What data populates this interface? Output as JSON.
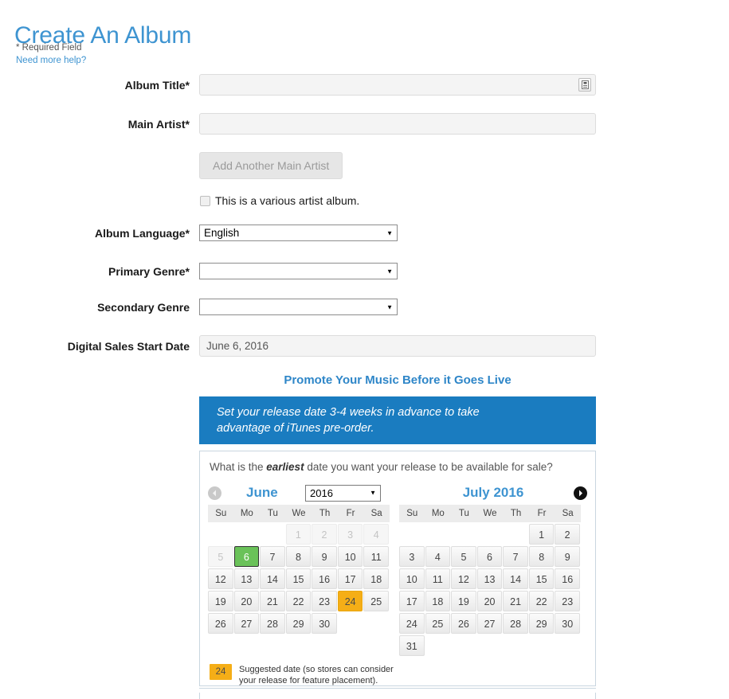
{
  "header": {
    "title": "Create An Album",
    "required_note": "* Required Field",
    "help_link": "Need more help?",
    "accent_blue": "#3e94d1"
  },
  "form": {
    "album_title": {
      "label": "Album Title*",
      "value": "",
      "icon": "id-card-icon"
    },
    "main_artist": {
      "label": "Main Artist*",
      "value": ""
    },
    "add_artist_button": "Add Another Main Artist",
    "various_artist_checkbox": {
      "label": "This is a various artist album.",
      "checked": false
    },
    "album_language": {
      "label": "Album Language*",
      "value": "English",
      "options": [
        "English"
      ]
    },
    "primary_genre": {
      "label": "Primary Genre*",
      "value": "",
      "options": [
        ""
      ]
    },
    "secondary_genre": {
      "label": "Secondary Genre",
      "value": "",
      "options": [
        ""
      ]
    },
    "digital_sales_start_date": {
      "label": "Digital Sales Start Date",
      "value": "June 6, 2016"
    }
  },
  "promo": {
    "heading": "Promote Your Music Before it Goes Live",
    "banner_line1": "Set your release date 3-4 weeks in advance to take",
    "banner_line2": "advantage of iTunes pre-order.",
    "banner_color": "#1a7cc0"
  },
  "calendar": {
    "question_pre": "What is the ",
    "question_em": "earliest",
    "question_post": " date you want your release to be available for sale?",
    "prev_arrow": "chevron-left-icon",
    "next_arrow": "chevron-right-icon",
    "year_select": {
      "value": "2016",
      "options": [
        "2016"
      ]
    },
    "dow": [
      "Su",
      "Mo",
      "Tu",
      "We",
      "Th",
      "Fr",
      "Sa"
    ],
    "selected_color": "#6ac259",
    "suggested_color": "#f5ae17",
    "months": [
      {
        "name": "June",
        "title": "June",
        "weeks": [
          [
            {
              "d": "",
              "state": "empty"
            },
            {
              "d": "",
              "state": "empty"
            },
            {
              "d": "",
              "state": "empty"
            },
            {
              "d": "1",
              "state": "disabled"
            },
            {
              "d": "2",
              "state": "disabled"
            },
            {
              "d": "3",
              "state": "disabled"
            },
            {
              "d": "4",
              "state": "disabled"
            }
          ],
          [
            {
              "d": "5",
              "state": "disabled"
            },
            {
              "d": "6",
              "state": "selected"
            },
            {
              "d": "7",
              "state": "normal"
            },
            {
              "d": "8",
              "state": "normal"
            },
            {
              "d": "9",
              "state": "normal"
            },
            {
              "d": "10",
              "state": "normal"
            },
            {
              "d": "11",
              "state": "normal"
            }
          ],
          [
            {
              "d": "12",
              "state": "normal"
            },
            {
              "d": "13",
              "state": "normal"
            },
            {
              "d": "14",
              "state": "normal"
            },
            {
              "d": "15",
              "state": "normal"
            },
            {
              "d": "16",
              "state": "normal"
            },
            {
              "d": "17",
              "state": "normal"
            },
            {
              "d": "18",
              "state": "normal"
            }
          ],
          [
            {
              "d": "19",
              "state": "normal"
            },
            {
              "d": "20",
              "state": "normal"
            },
            {
              "d": "21",
              "state": "normal"
            },
            {
              "d": "22",
              "state": "normal"
            },
            {
              "d": "23",
              "state": "normal"
            },
            {
              "d": "24",
              "state": "suggested"
            },
            {
              "d": "25",
              "state": "normal"
            }
          ],
          [
            {
              "d": "26",
              "state": "normal"
            },
            {
              "d": "27",
              "state": "normal"
            },
            {
              "d": "28",
              "state": "normal"
            },
            {
              "d": "29",
              "state": "normal"
            },
            {
              "d": "30",
              "state": "normal"
            },
            {
              "d": "",
              "state": "empty"
            },
            {
              "d": "",
              "state": "empty"
            }
          ]
        ]
      },
      {
        "name": "July",
        "title": "July 2016",
        "weeks": [
          [
            {
              "d": "",
              "state": "empty"
            },
            {
              "d": "",
              "state": "empty"
            },
            {
              "d": "",
              "state": "empty"
            },
            {
              "d": "",
              "state": "empty"
            },
            {
              "d": "",
              "state": "empty"
            },
            {
              "d": "1",
              "state": "normal"
            },
            {
              "d": "2",
              "state": "normal"
            }
          ],
          [
            {
              "d": "3",
              "state": "normal"
            },
            {
              "d": "4",
              "state": "normal"
            },
            {
              "d": "5",
              "state": "normal"
            },
            {
              "d": "6",
              "state": "normal"
            },
            {
              "d": "7",
              "state": "normal"
            },
            {
              "d": "8",
              "state": "normal"
            },
            {
              "d": "9",
              "state": "normal"
            }
          ],
          [
            {
              "d": "10",
              "state": "normal"
            },
            {
              "d": "11",
              "state": "normal"
            },
            {
              "d": "12",
              "state": "normal"
            },
            {
              "d": "13",
              "state": "normal"
            },
            {
              "d": "14",
              "state": "normal"
            },
            {
              "d": "15",
              "state": "normal"
            },
            {
              "d": "16",
              "state": "normal"
            }
          ],
          [
            {
              "d": "17",
              "state": "normal"
            },
            {
              "d": "18",
              "state": "normal"
            },
            {
              "d": "19",
              "state": "normal"
            },
            {
              "d": "20",
              "state": "normal"
            },
            {
              "d": "21",
              "state": "normal"
            },
            {
              "d": "22",
              "state": "normal"
            },
            {
              "d": "23",
              "state": "normal"
            }
          ],
          [
            {
              "d": "24",
              "state": "normal"
            },
            {
              "d": "25",
              "state": "normal"
            },
            {
              "d": "26",
              "state": "normal"
            },
            {
              "d": "27",
              "state": "normal"
            },
            {
              "d": "28",
              "state": "normal"
            },
            {
              "d": "29",
              "state": "normal"
            },
            {
              "d": "30",
              "state": "normal"
            }
          ],
          [
            {
              "d": "31",
              "state": "normal"
            },
            {
              "d": "",
              "state": "empty"
            },
            {
              "d": "",
              "state": "empty"
            },
            {
              "d": "",
              "state": "empty"
            },
            {
              "d": "",
              "state": "empty"
            },
            {
              "d": "",
              "state": "empty"
            },
            {
              "d": "",
              "state": "empty"
            }
          ]
        ]
      }
    ],
    "legend": {
      "chip": "24",
      "line1": "Suggested date (so stores can consider",
      "line2": "your release for feature placement)."
    }
  }
}
